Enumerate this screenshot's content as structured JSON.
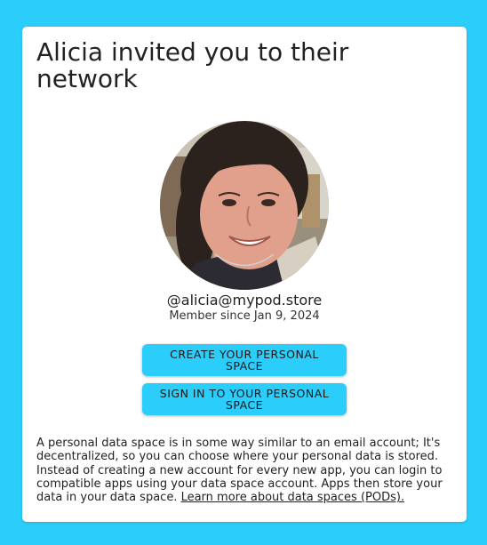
{
  "invite": {
    "title": "Alicia invited you to their network",
    "handle": "@alicia@mypod.store",
    "member_since": "Member since Jan 9, 2024"
  },
  "buttons": {
    "create_label": "CREATE YOUR PERSONAL SPACE",
    "signin_label": "SIGN IN TO YOUR PERSONAL SPACE"
  },
  "description": {
    "text": "A personal data space is in some way similar to an email account; It's decentralized, so you can choose where your personal data is stored. Instead of creating a new account for every new app, you can login to compatible apps using your data space account. Apps then store your data in your data space. ",
    "link_label": "Learn more about data spaces (PODs)."
  },
  "colors": {
    "background": "#2bcdfb",
    "button": "#2bcdfb",
    "card": "#ffffff",
    "text": "#222222"
  },
  "icons": {
    "avatar": "user-photo"
  }
}
